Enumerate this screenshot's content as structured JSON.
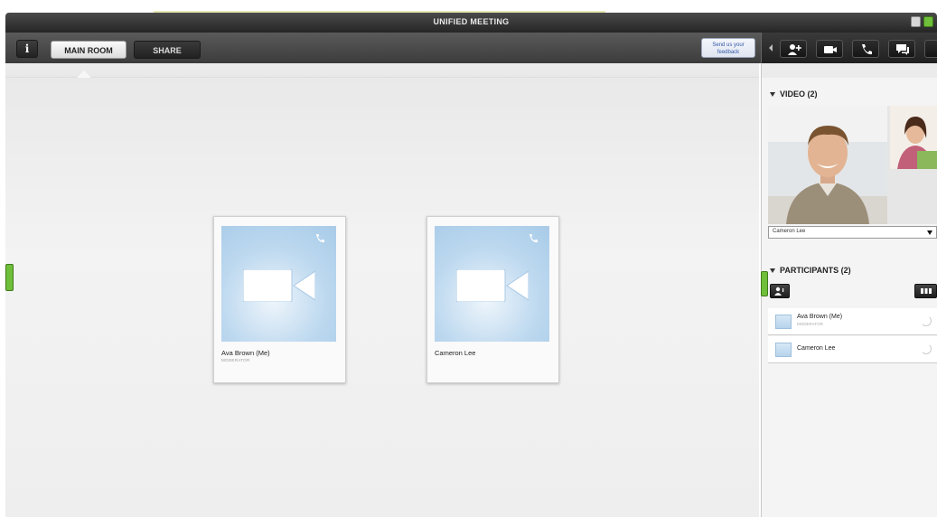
{
  "window": {
    "title": "UNIFIED MEETING"
  },
  "toolbar": {
    "info_label": "i",
    "tabs": [
      {
        "label": "MAIN ROOM"
      },
      {
        "label": "SHARE"
      }
    ],
    "feedback_label": "Send us your feedback",
    "right_buttons": [
      "back-icon",
      "add-participant-icon",
      "video-camera-icon",
      "phone-icon",
      "chat-icon"
    ]
  },
  "stage": {
    "participants": [
      {
        "name": "Ava Brown (Me)",
        "role": "MODERATOR"
      },
      {
        "name": "Cameron Lee",
        "role": ""
      }
    ]
  },
  "video_panel": {
    "header": "VIDEO (2)",
    "selected_feed": "Cameron Lee"
  },
  "participants_panel": {
    "header": "PARTICIPANTS (2)",
    "list": [
      {
        "name": "Ava Brown (Me)",
        "role": "MODERATOR"
      },
      {
        "name": "Cameron Lee",
        "role": ""
      }
    ]
  },
  "colors": {
    "accent_green": "#6fbf3a",
    "tile_blue": "#bcd8ef",
    "feedback_text": "#3357a8"
  }
}
